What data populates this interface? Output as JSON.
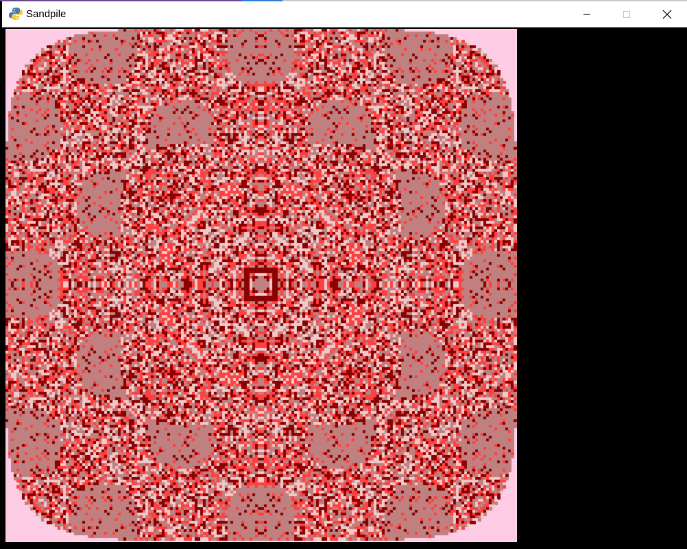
{
  "window": {
    "title": "Sandpile",
    "icon": "python-icon",
    "controls": [
      "minimize-icon",
      "maximize-icon",
      "close-icon"
    ]
  },
  "sandpile": {
    "colors": {
      "background": "#ffcce6",
      "fill": "#c08080",
      "dark": "#8b0000",
      "bright": "#ff4040",
      "light": "#f0c8c8"
    },
    "shape": "rounded-square",
    "grid_cells": 186
  }
}
